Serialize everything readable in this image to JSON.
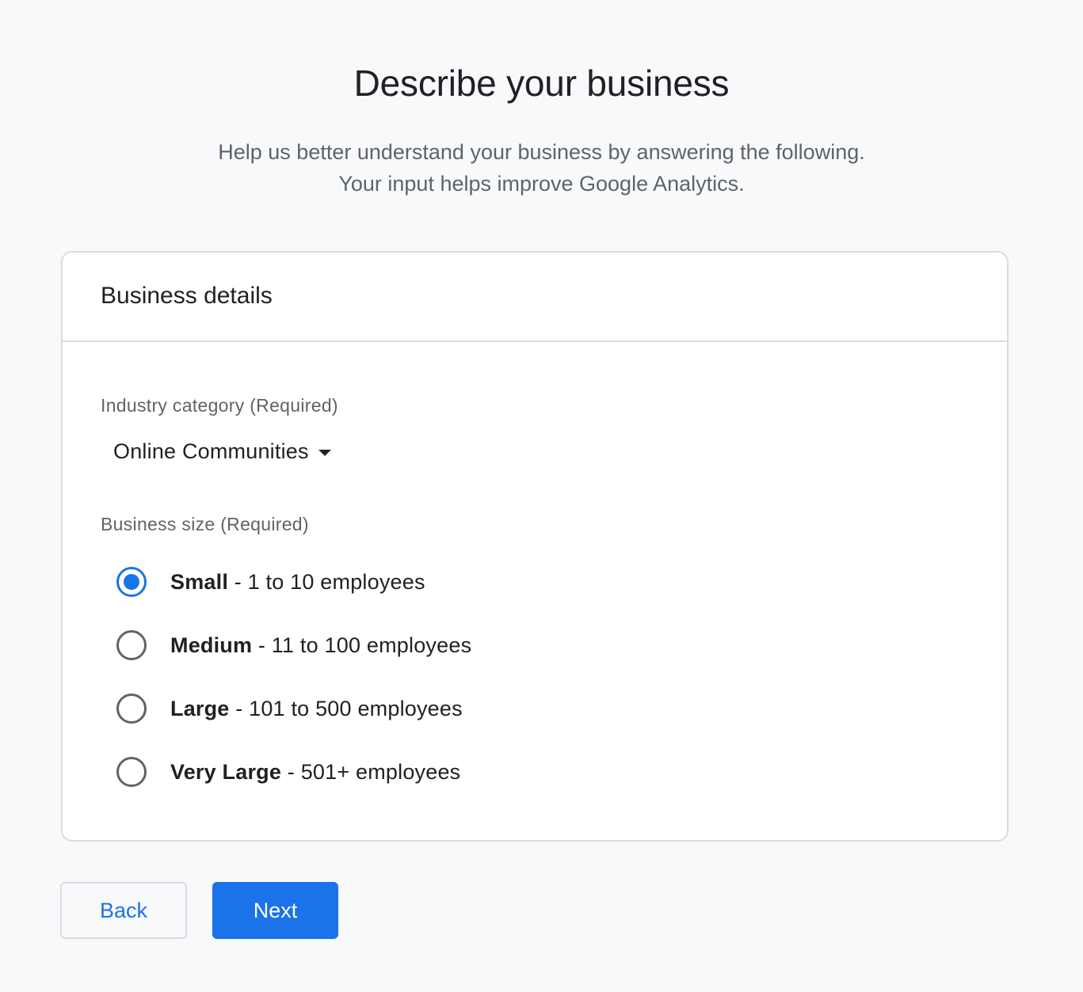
{
  "header": {
    "title": "Describe your business",
    "subtitle_line1": "Help us better understand your business by answering the following.",
    "subtitle_line2": "Your input helps improve Google Analytics."
  },
  "card": {
    "title": "Business details",
    "industry": {
      "label": "Industry category (Required)",
      "value": "Online Communities",
      "icon": "chevron-down-icon"
    },
    "business_size": {
      "label": "Business size (Required)",
      "selected": "Small",
      "options": [
        {
          "name": "Small",
          "detail": " - 1 to 10 employees",
          "checked": true
        },
        {
          "name": "Medium",
          "detail": " - 11 to 100 employees",
          "checked": false
        },
        {
          "name": "Large",
          "detail": " - 101 to 500 employees",
          "checked": false
        },
        {
          "name": "Very Large",
          "detail": " - 501+ employees",
          "checked": false
        }
      ]
    }
  },
  "actions": {
    "back_label": "Back",
    "next_label": "Next"
  },
  "colors": {
    "accent": "#1a73e8",
    "background": "#f8f9fa",
    "border": "#dadce0",
    "text_primary": "#202124",
    "text_secondary": "#5f6368"
  }
}
